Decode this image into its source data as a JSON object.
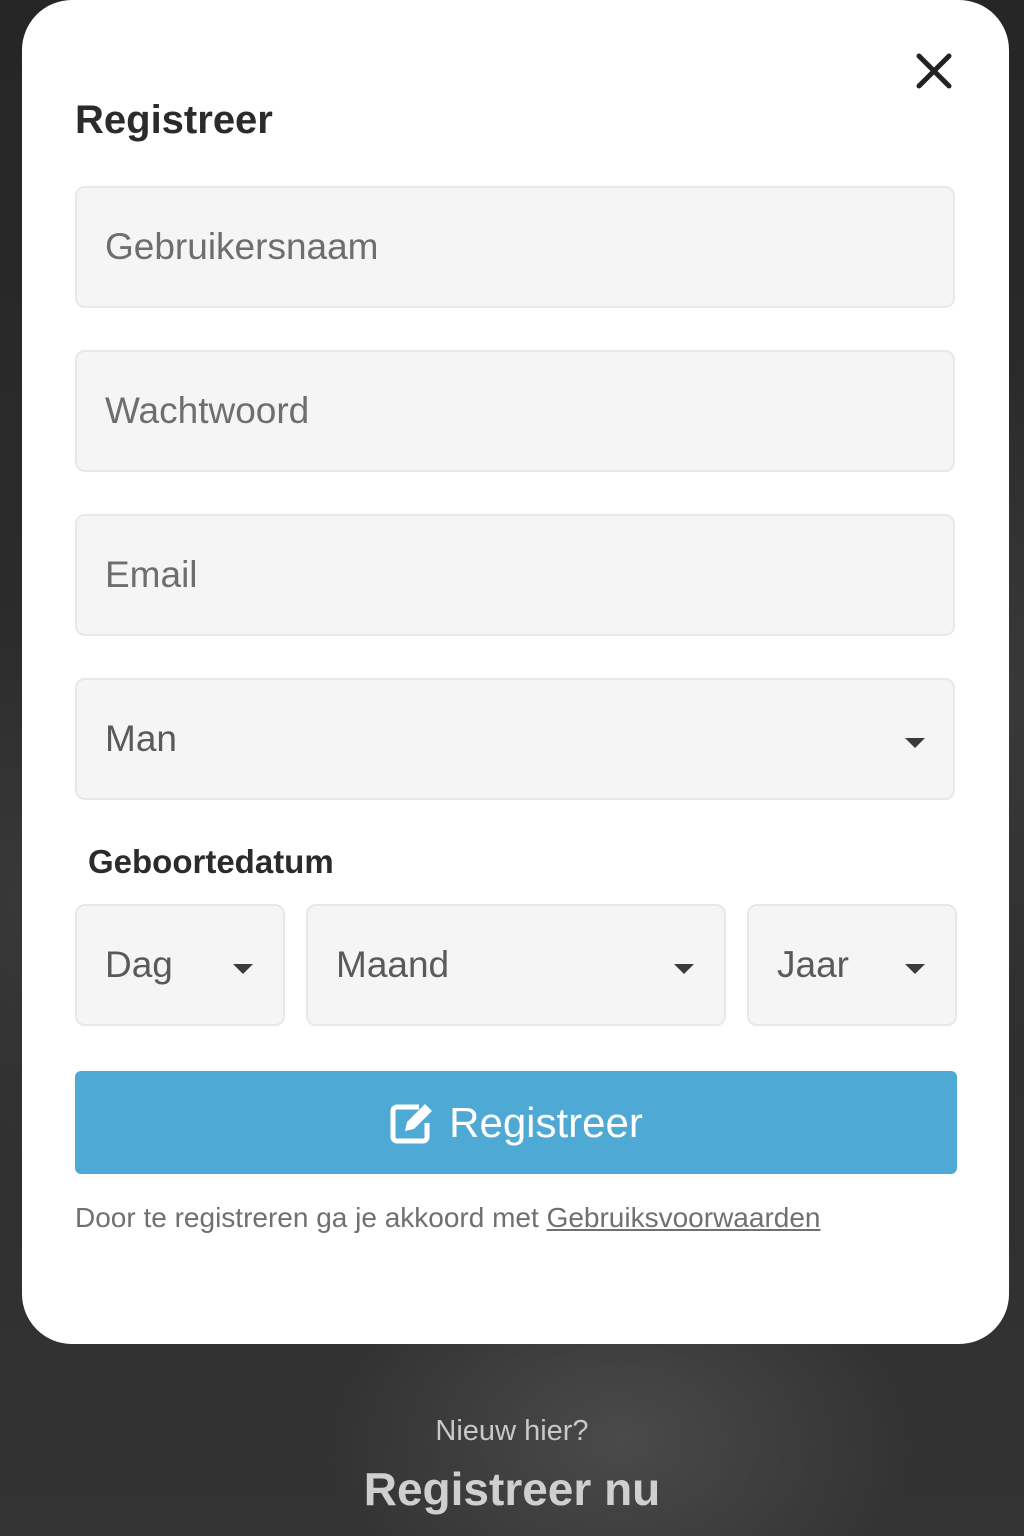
{
  "modal": {
    "title": "Registreer",
    "close_icon": "close-icon"
  },
  "form": {
    "username": {
      "placeholder": "Gebruikersnaam",
      "value": ""
    },
    "password": {
      "placeholder": "Wachtwoord",
      "value": ""
    },
    "email": {
      "placeholder": "Email",
      "value": ""
    },
    "gender": {
      "selected": "Man",
      "icon": "caret-down-icon"
    },
    "birthdate": {
      "label": "Geboortedatum",
      "day": {
        "selected": "Dag"
      },
      "month": {
        "selected": "Maand"
      },
      "year": {
        "selected": "Jaar"
      }
    },
    "submit": {
      "label": "Registreer",
      "icon": "edit-icon"
    },
    "terms": {
      "text": "Door te registreren ga je akkoord met ",
      "link": "Gebruiksvoorwaarden"
    }
  },
  "footer": {
    "prompt": "Nieuw hier?",
    "cta": "Registreer nu"
  },
  "colors": {
    "accent": "#4fa9d5",
    "field_bg": "#f5f5f5",
    "overlay": "#2a2a2a"
  }
}
